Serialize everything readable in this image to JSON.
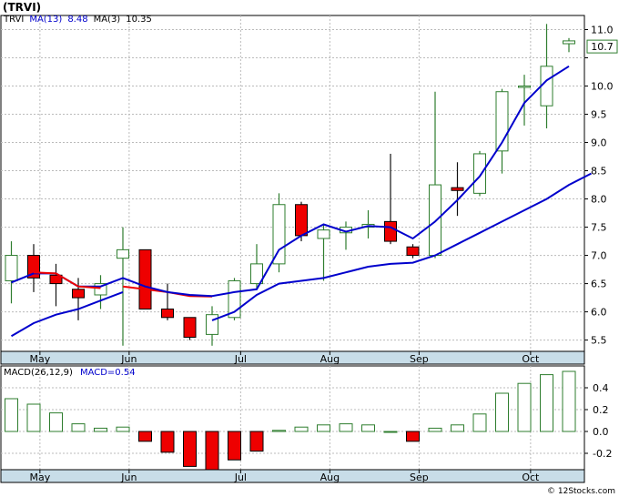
{
  "title": "(TRVI)",
  "watermark": "© 12Stocks.com",
  "chart_data": [
    {
      "type": "candlestick",
      "legend": [
        {
          "text": "TRVI",
          "color": "#000000"
        },
        {
          "text": "MA(13)",
          "color": "#0000cc"
        },
        {
          "text": "8.48",
          "color": "#0000cc"
        },
        {
          "text": "MA(3)",
          "color": "#000000"
        },
        {
          "text": "10.35",
          "color": "#000000"
        }
      ],
      "ylim": [
        5.3,
        11.25
      ],
      "y_ticks": [
        5.5,
        6.0,
        6.5,
        7.0,
        7.5,
        8.0,
        8.5,
        9.0,
        9.5,
        10.0,
        10.5,
        11.0
      ],
      "y_tick_labels": [
        "5.5",
        "6.0",
        "6.5",
        "7.0",
        "7.5",
        "8.0",
        "8.5",
        "9.0",
        "9.5",
        "10.0",
        "",
        "11.0"
      ],
      "last_price_label": "10.7",
      "last_price": 10.7,
      "months": [
        {
          "label": "May",
          "index": 1.28
        },
        {
          "label": "Jun",
          "index": 5.28
        },
        {
          "label": "Jul",
          "index": 10.28
        },
        {
          "label": "Aug",
          "index": 14.28
        },
        {
          "label": "Sep",
          "index": 18.28
        },
        {
          "label": "Oct",
          "index": 23.28
        }
      ],
      "candles": [
        {
          "o": 6.55,
          "h": 7.25,
          "l": 6.15,
          "c": 7.0
        },
        {
          "o": 7.0,
          "h": 7.2,
          "l": 6.35,
          "c": 6.6
        },
        {
          "o": 6.65,
          "h": 6.85,
          "l": 6.1,
          "c": 6.5
        },
        {
          "o": 6.4,
          "h": 6.6,
          "l": 5.85,
          "c": 6.25
        },
        {
          "o": 6.3,
          "h": 6.65,
          "l": 6.05,
          "c": 6.5
        },
        {
          "o": 6.95,
          "h": 7.5,
          "l": 5.4,
          "c": 7.1
        },
        {
          "o": 7.1,
          "h": 7.1,
          "l": 6.05,
          "c": 6.05
        },
        {
          "o": 6.05,
          "h": 6.5,
          "l": 5.85,
          "c": 5.9
        },
        {
          "o": 5.9,
          "h": 5.9,
          "l": 5.5,
          "c": 5.55
        },
        {
          "o": 5.6,
          "h": 6.1,
          "l": 5.4,
          "c": 5.95
        },
        {
          "o": 5.9,
          "h": 6.6,
          "l": 5.85,
          "c": 6.55
        },
        {
          "o": 6.5,
          "h": 7.2,
          "l": 6.4,
          "c": 6.85
        },
        {
          "o": 6.85,
          "h": 8.1,
          "l": 6.7,
          "c": 7.9
        },
        {
          "o": 7.9,
          "h": 7.95,
          "l": 7.25,
          "c": 7.35
        },
        {
          "o": 7.3,
          "h": 7.55,
          "l": 6.55,
          "c": 7.45
        },
        {
          "o": 7.4,
          "h": 7.6,
          "l": 7.1,
          "c": 7.5
        },
        {
          "o": 7.5,
          "h": 7.8,
          "l": 7.3,
          "c": 7.55
        },
        {
          "o": 7.6,
          "h": 8.8,
          "l": 7.2,
          "c": 7.25
        },
        {
          "o": 7.15,
          "h": 7.2,
          "l": 6.95,
          "c": 7.0
        },
        {
          "o": 7.0,
          "h": 9.9,
          "l": 6.95,
          "c": 8.25
        },
        {
          "o": 8.2,
          "h": 8.65,
          "l": 7.7,
          "c": 8.15
        },
        {
          "o": 8.1,
          "h": 8.85,
          "l": 8.05,
          "c": 8.8
        },
        {
          "o": 8.85,
          "h": 9.95,
          "l": 8.45,
          "c": 9.9
        },
        {
          "o": 10.0,
          "h": 10.2,
          "l": 9.3,
          "c": 10.0
        },
        {
          "o": 9.65,
          "h": 11.1,
          "l": 9.25,
          "c": 10.35
        },
        {
          "o": 10.75,
          "h": 10.85,
          "l": 10.6,
          "c": 10.8
        }
      ],
      "series": [
        {
          "name": "MA(13)",
          "color": "#0000cc",
          "values": [
            5.57,
            5.8,
            5.95,
            6.05,
            6.2,
            6.35,
            null,
            null,
            null,
            5.85,
            6.0,
            6.3,
            6.5,
            6.55,
            6.6,
            6.7,
            6.8,
            6.85,
            6.87,
            7.0,
            7.2,
            7.4,
            7.6,
            7.8,
            8.0,
            8.25,
            8.45
          ]
        },
        {
          "name": "MA(3)",
          "color": "#0000cc",
          "values": [
            6.52,
            6.68,
            6.68,
            6.45,
            6.45,
            6.6,
            6.45,
            6.35,
            6.3,
            6.28,
            6.35,
            6.4,
            7.1,
            7.35,
            7.55,
            7.42,
            7.52,
            7.5,
            7.3,
            7.6,
            7.98,
            8.4,
            9.0,
            9.7,
            10.1,
            10.35
          ]
        }
      ],
      "ma13_red_segment": [
        {
          "i": 5,
          "v": 6.45
        },
        {
          "i": 6,
          "v": 6.4
        },
        {
          "i": 7,
          "v": 6.35
        },
        {
          "i": 8,
          "v": 6.28
        },
        {
          "i": 9,
          "v": 6.27
        }
      ],
      "ma3_red_segment": [
        {
          "i": 1,
          "v": 6.7
        },
        {
          "i": 2,
          "v": 6.68
        },
        {
          "i": 3,
          "v": 6.45
        },
        {
          "i": 4,
          "v": 6.42
        }
      ]
    },
    {
      "type": "bar",
      "legend": [
        {
          "text": "MACD(26,12,9)",
          "color": "#000000"
        },
        {
          "text": "MACD=0.54",
          "color": "#0000cc"
        }
      ],
      "ylim": [
        -0.35,
        0.6
      ],
      "y_ticks": [
        -0.2,
        0.0,
        0.2,
        0.4
      ],
      "y_tick_labels": [
        "-0.2",
        "0.0",
        "0.2",
        "0.4"
      ],
      "values": [
        0.3,
        0.25,
        0.17,
        0.07,
        0.03,
        0.04,
        -0.09,
        -0.19,
        -0.32,
        -0.36,
        -0.26,
        -0.18,
        0.01,
        0.04,
        0.06,
        0.07,
        0.06,
        0.0,
        -0.09,
        0.03,
        0.06,
        0.16,
        0.35,
        0.44,
        0.52,
        0.55
      ]
    }
  ]
}
